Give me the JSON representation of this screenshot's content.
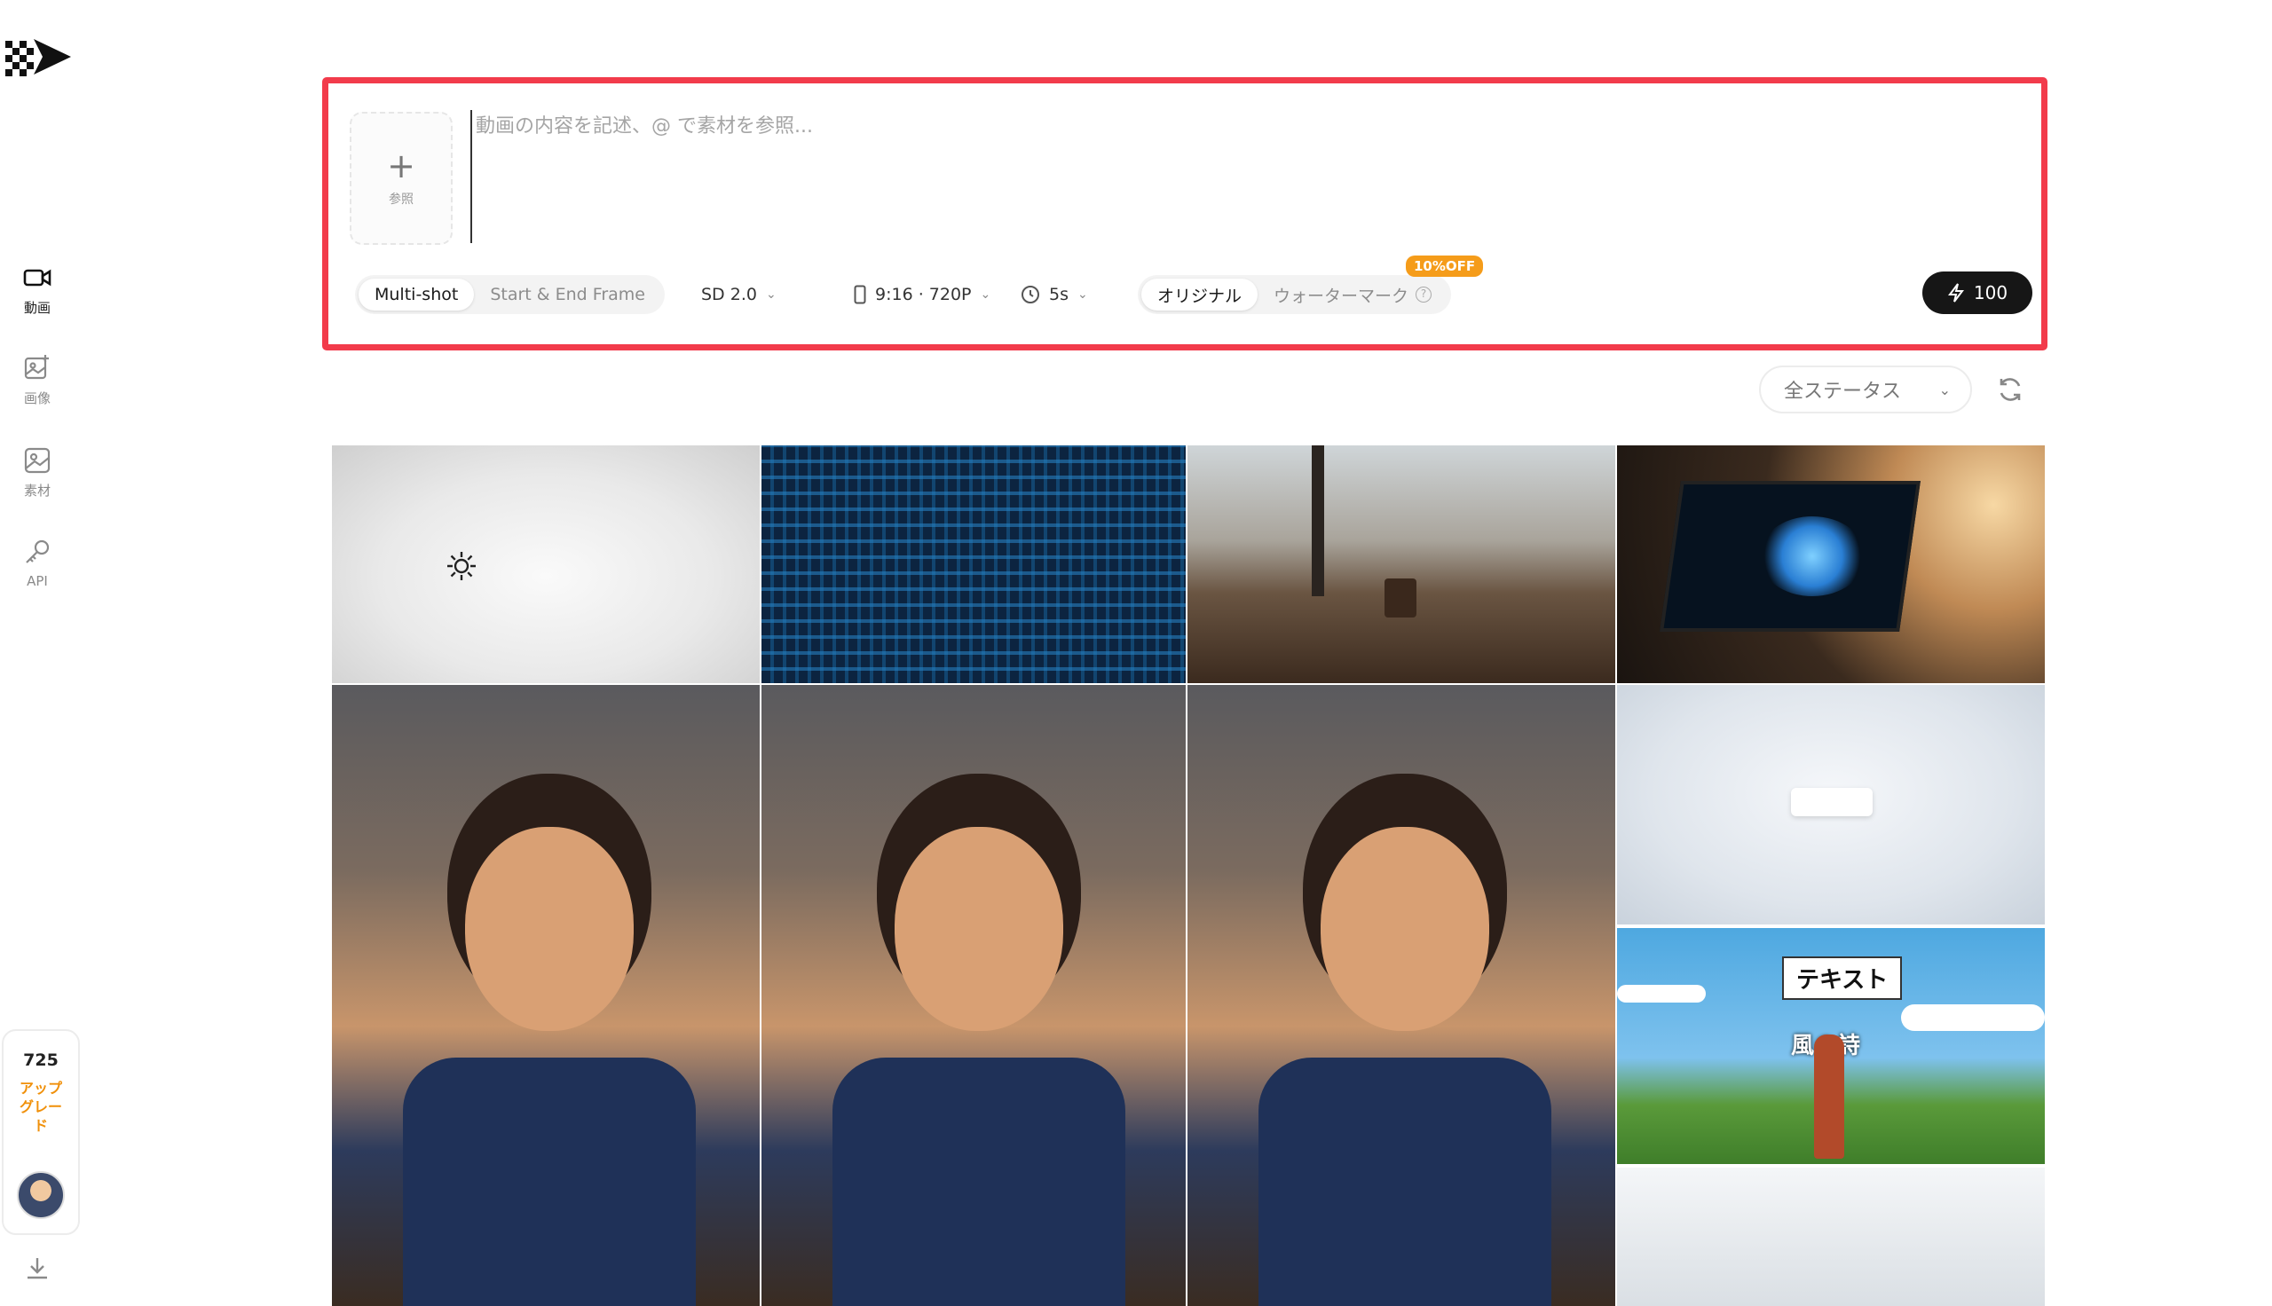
{
  "sidebar": {
    "nav": [
      {
        "label": "動画",
        "icon": "video-camera-icon",
        "active": true
      },
      {
        "label": "画像",
        "icon": "image-add-icon",
        "active": false
      },
      {
        "label": "素材",
        "icon": "image-icon",
        "active": false
      },
      {
        "label": "API",
        "icon": "key-icon",
        "active": false
      }
    ],
    "credits": "725",
    "upgrade_label": "アップグレード"
  },
  "composer": {
    "reference_label": "参照",
    "prompt_placeholder": "動画の内容を記述、@ で素材を参照...",
    "mode_options": [
      "Multi-shot",
      "Start & End Frame"
    ],
    "selected_mode": "Multi-shot",
    "model": "SD 2.0",
    "aspect_resolution": "9:16 · 720P",
    "duration": "5s",
    "watermark_options": [
      "オリジナル",
      "ウォーターマーク"
    ],
    "selected_watermark": "オリジナル",
    "discount_badge": "10%OFF",
    "generate_cost": "100"
  },
  "filters": {
    "status_value": "全ステータス"
  },
  "gallery": {
    "tile_texts": {
      "field_caption": "テキスト",
      "field_subtitle": "風の詩"
    }
  },
  "colors": {
    "highlight_frame": "#f23b4b",
    "badge": "#f59c1a",
    "upgrade": "#f0900a",
    "primary_button": "#161616"
  }
}
